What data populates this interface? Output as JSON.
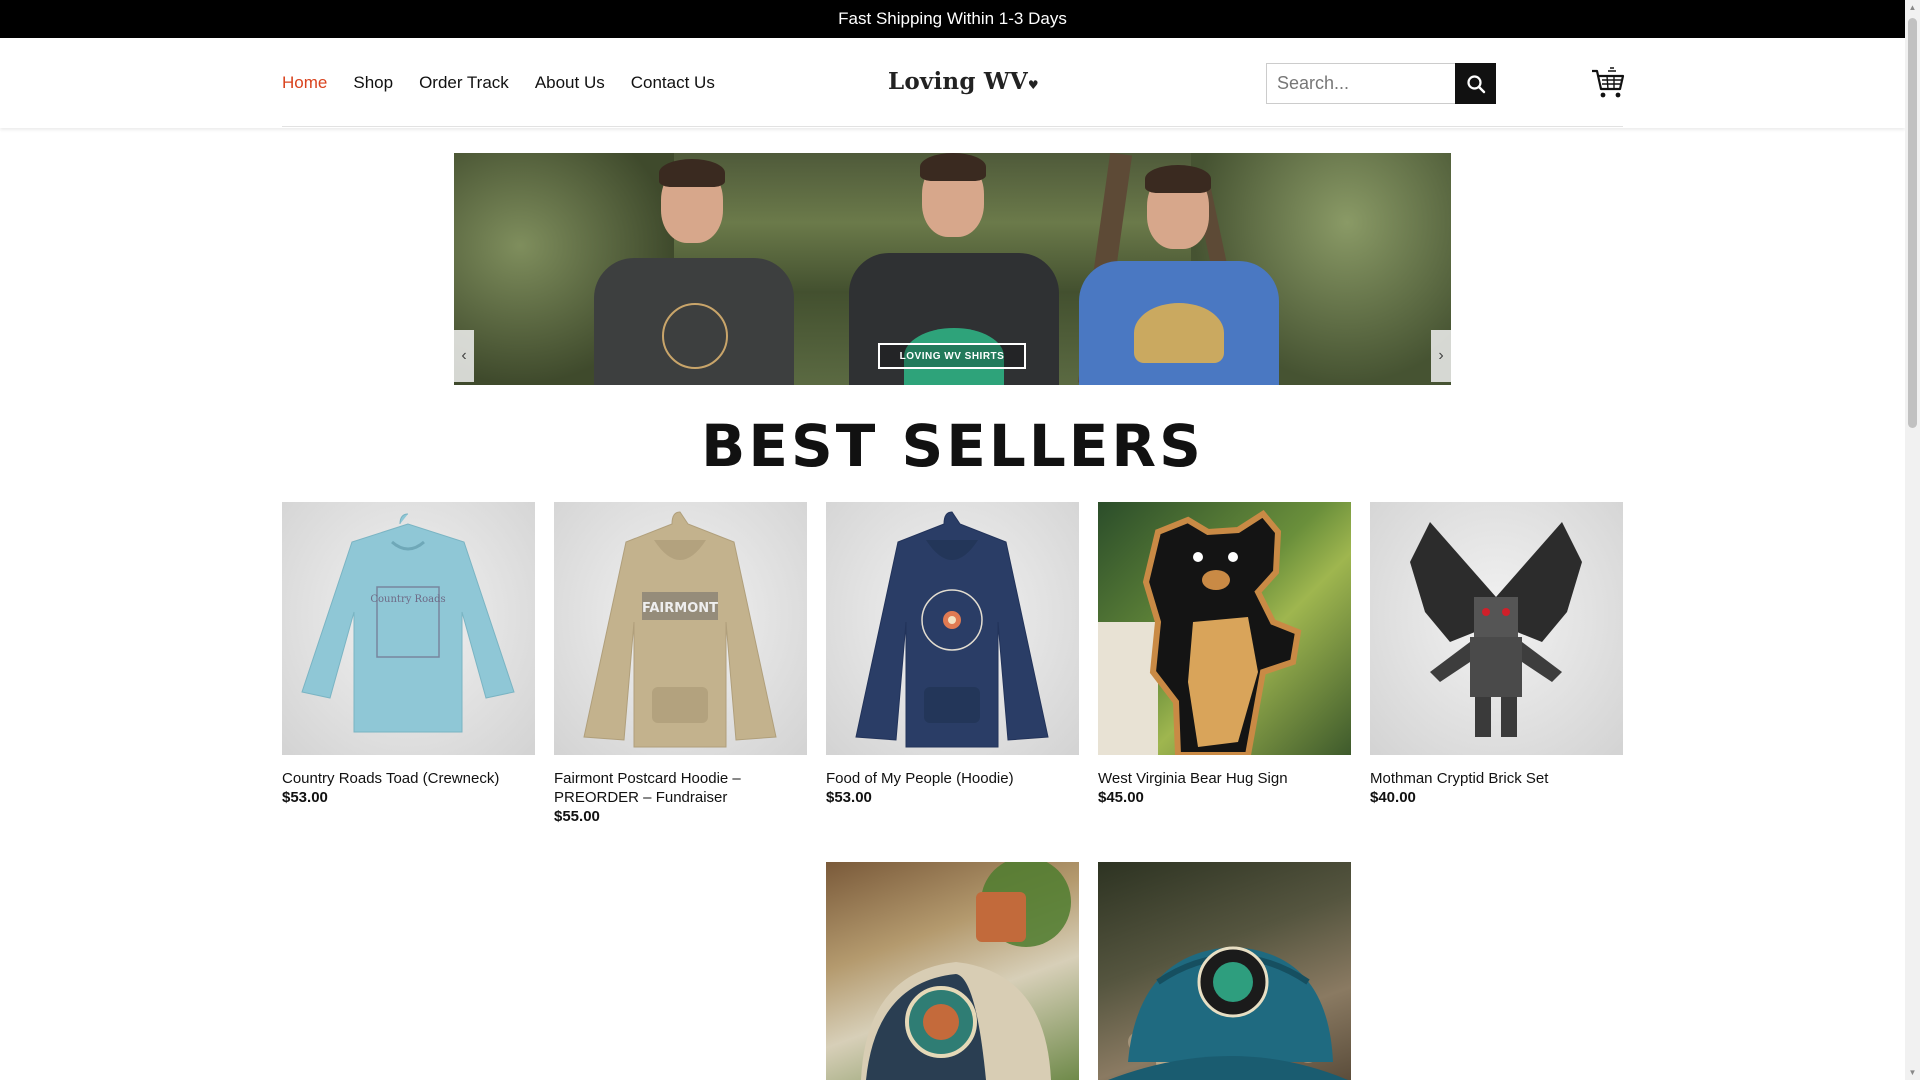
{
  "announcement": "Fast Shipping Within 1-3 Days",
  "nav": {
    "items": [
      {
        "label": "Home",
        "active": true
      },
      {
        "label": "Shop"
      },
      {
        "label": "Order Track"
      },
      {
        "label": "About Us"
      },
      {
        "label": "Contact Us"
      }
    ]
  },
  "logo": {
    "text": "Loving WV",
    "heart": "♥"
  },
  "search": {
    "placeholder": "Search..."
  },
  "banner": {
    "label": "LOVING WV SHIRTS",
    "prev_icon": "‹",
    "next_icon": "›"
  },
  "section_title": "BEST SELLERS",
  "products": [
    {
      "name": "Country Roads Toad (Crewneck)",
      "price": "$53.00"
    },
    {
      "name": "Fairmont Postcard Hoodie – PREORDER – Fundraiser",
      "price": "$55.00"
    },
    {
      "name": "Food of My People (Hoodie)",
      "price": "$53.00"
    },
    {
      "name": "West Virginia Bear Hug Sign",
      "price": "$45.00"
    },
    {
      "name": "Mothman Cryptid Brick Set",
      "price": "$40.00"
    }
  ],
  "colors": {
    "accent": "#d9431e",
    "topbar": "#000000"
  }
}
